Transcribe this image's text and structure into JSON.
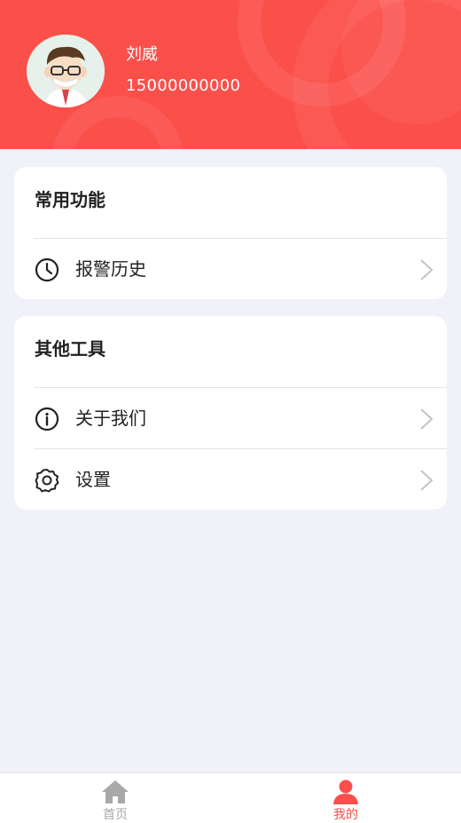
{
  "user": {
    "name": "刘威",
    "phone": "15000000000"
  },
  "sections": [
    {
      "title": "常用功能",
      "items": [
        {
          "label": "报警历史",
          "icon": "clock-icon"
        }
      ]
    },
    {
      "title": "其他工具",
      "items": [
        {
          "label": "关于我们",
          "icon": "info-icon"
        },
        {
          "label": "设置",
          "icon": "gear-icon"
        }
      ]
    }
  ],
  "tabbar": {
    "tabs": [
      {
        "label": "首页",
        "icon": "home-icon",
        "active": false
      },
      {
        "label": "我的",
        "icon": "person-icon",
        "active": true
      }
    ]
  },
  "colors": {
    "accent": "#fb4f4a",
    "background": "#f1f1fa",
    "inactive_tab": "#a8a8a8"
  }
}
